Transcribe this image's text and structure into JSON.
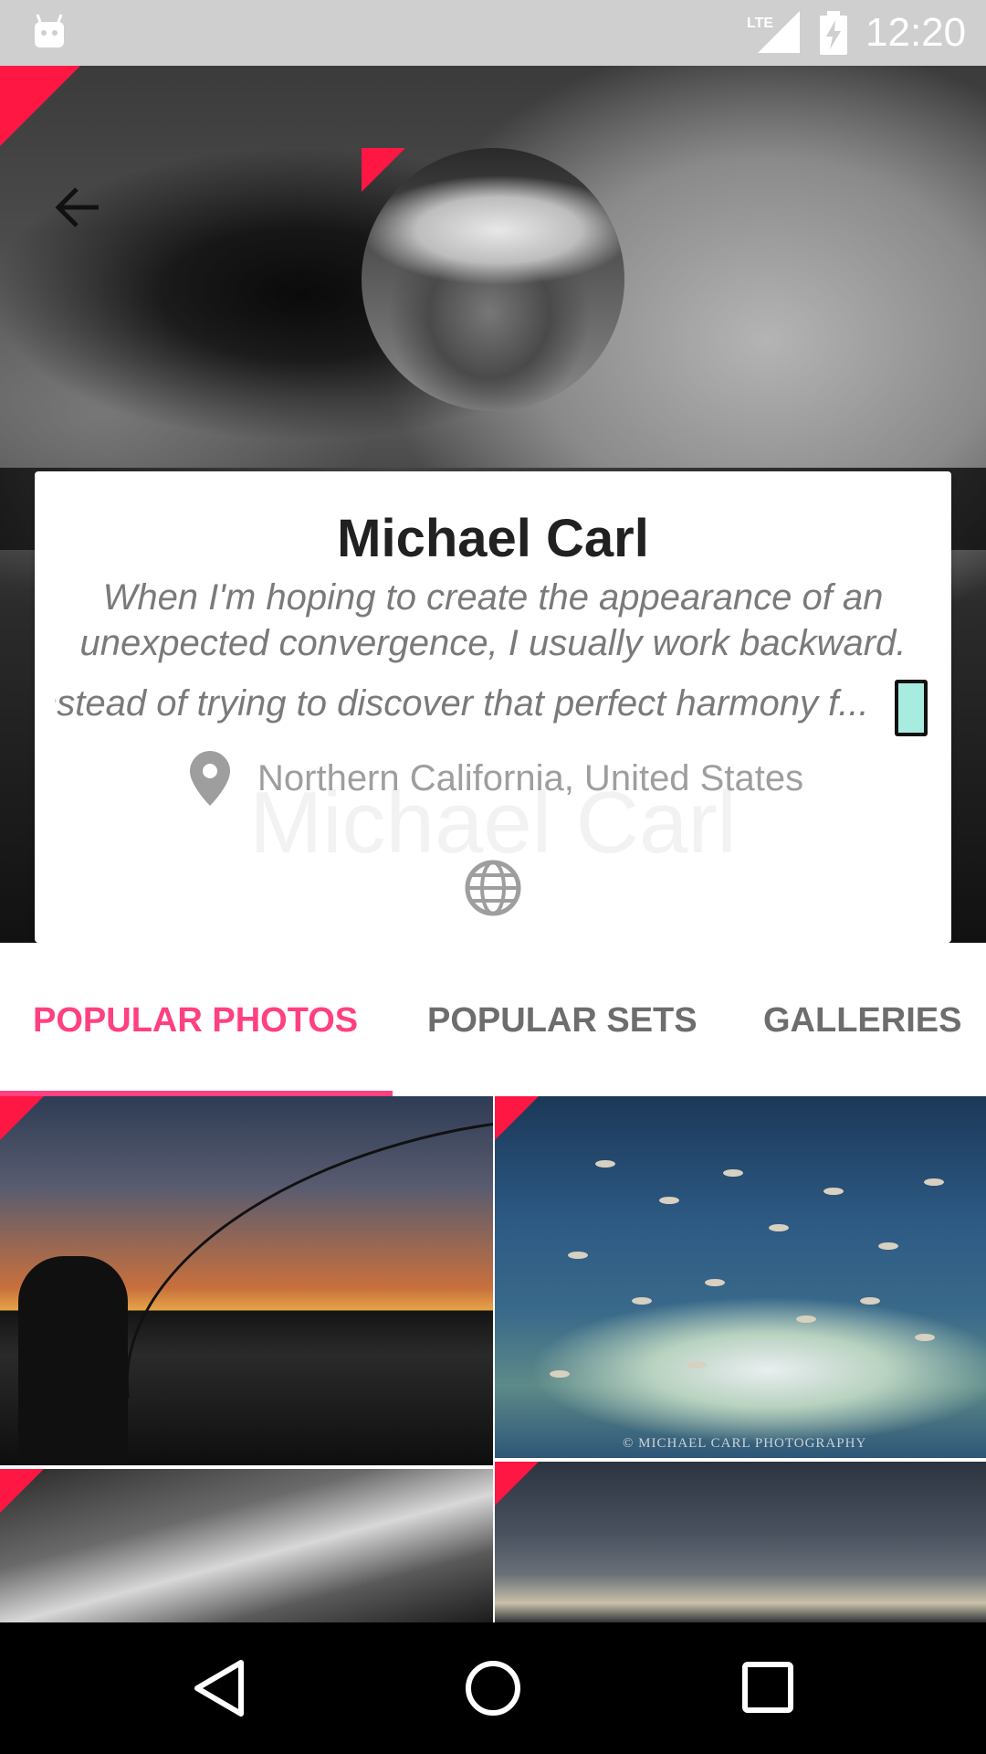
{
  "status_bar": {
    "time": "12:20",
    "network": "LTE",
    "icons": [
      "android-debug-icon",
      "lte-signal-icon",
      "battery-charging-icon"
    ]
  },
  "header": {
    "back_icon": "arrow-back-icon"
  },
  "profile": {
    "name": "Michael Carl",
    "bio_line_1": "When I'm hoping to create the appearance of an",
    "bio_line_2": "unexpected convergence, I usually work backward.",
    "bio_line_3": "nstead of trying to discover that perfect harmony f...",
    "location": "Northern California, United States",
    "location_icon": "map-pin-icon",
    "website_icon": "globe-icon"
  },
  "tabs": [
    {
      "label": "POPULAR PHOTOS",
      "selected": true
    },
    {
      "label": "POPULAR SETS",
      "selected": false
    },
    {
      "label": "GALLERIES",
      "selected": false
    }
  ],
  "photos": {
    "watermark_text": "© MICHAEL CARL PHOTOGRAPHY"
  },
  "colors": {
    "accent": "#ff4081",
    "flag": "#ff1744",
    "status_bar": "#cfcfcf",
    "nav_bar": "#000000"
  },
  "nav_bar": {
    "icons": [
      "back-triangle-icon",
      "home-circle-icon",
      "recents-square-icon"
    ]
  }
}
